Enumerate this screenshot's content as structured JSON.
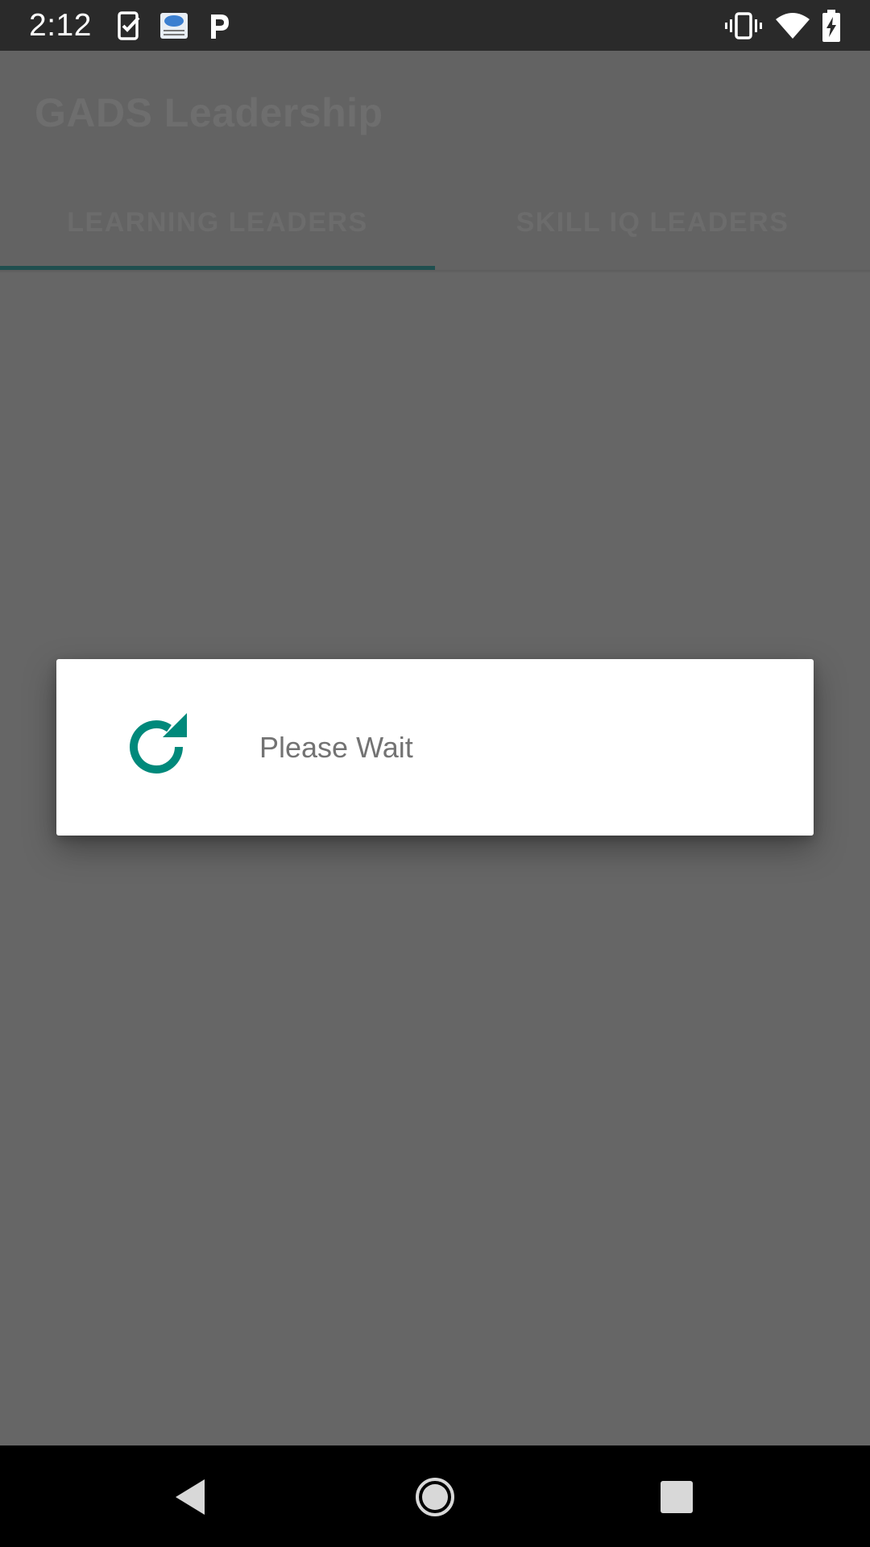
{
  "status_bar": {
    "time": "2:12",
    "notification_icons": [
      "task-check-icon",
      "cloud-calendar-icon",
      "p-letter-icon"
    ],
    "system_icons": [
      "vibrate-icon",
      "wifi-icon",
      "battery-charging-icon"
    ]
  },
  "app_bar": {
    "title": "GADS Leadership",
    "tabs": [
      {
        "label": "LEARNING LEADERS",
        "selected": true
      },
      {
        "label": "SKILL IQ LEADERS",
        "selected": false
      }
    ]
  },
  "dialog": {
    "icon": "refresh-icon",
    "message": "Please Wait"
  },
  "nav_bar": {
    "buttons": [
      "back-icon",
      "home-icon",
      "recents-icon"
    ]
  },
  "colors": {
    "accent": "#00897B",
    "tab_indicator": "#1F4F4F",
    "scrim_background": "#666666",
    "status_bar": "#2A2A2A"
  }
}
